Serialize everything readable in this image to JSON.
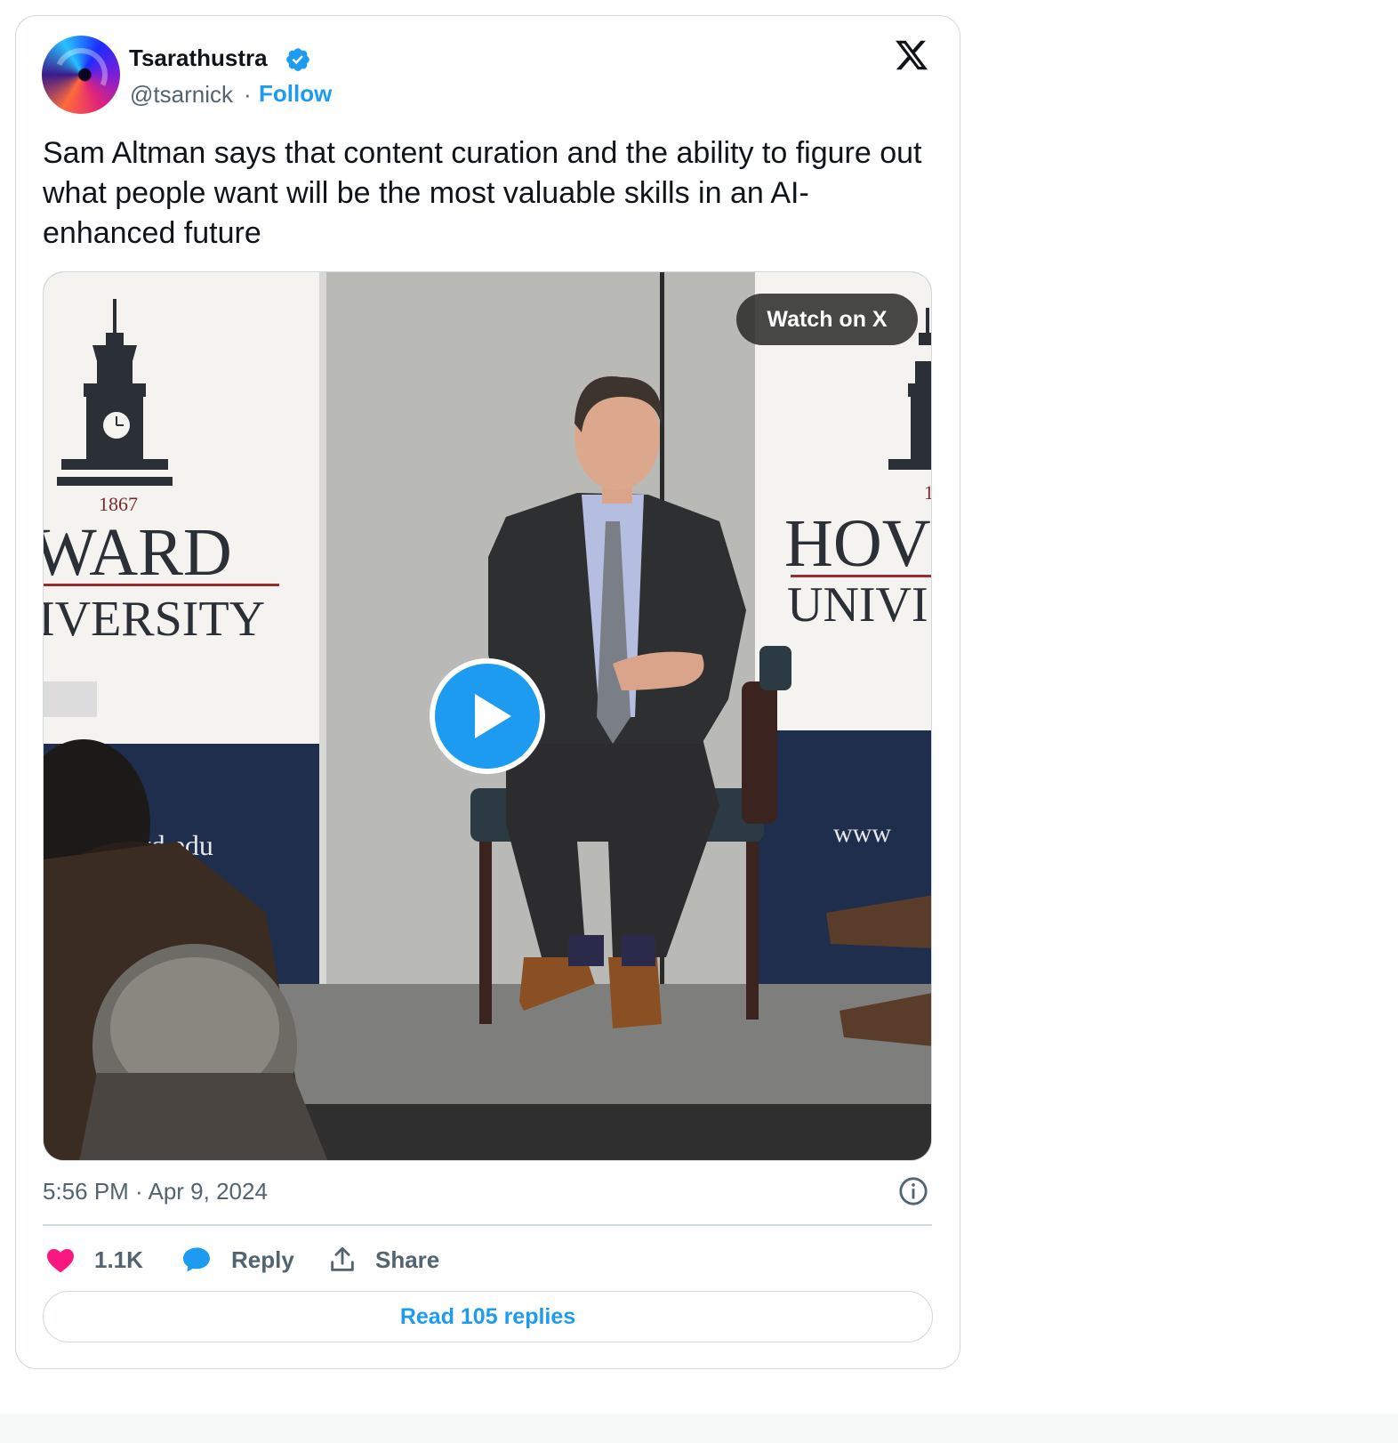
{
  "author": {
    "name": "Tsarathustra",
    "handle": "@tsarnick",
    "separator": "·",
    "follow_label": "Follow",
    "verified": true
  },
  "tweet": {
    "text": "Sam Altman says that content curation and the ability to figure out what people want will be the most valuable skills in an AI-enhanced future",
    "timestamp": "5:56 PM · Apr 9, 2024"
  },
  "media": {
    "watch_label": "Watch on X",
    "banner_left": {
      "year": "1867",
      "line1": "WARD",
      "line2": "IVERSITY",
      "url_fragment": "rd.edu"
    },
    "banner_right": {
      "year": "1",
      "line1": "HOV",
      "line2": "UNIVI",
      "url_fragment": "www"
    }
  },
  "actions": {
    "like_count": "1.1K",
    "reply_label": "Reply",
    "share_label": "Share",
    "read_replies_label": "Read 105 replies"
  },
  "colors": {
    "accent": "#1d9bf0",
    "like": "#f91880",
    "text_secondary": "#536471",
    "border": "#cfd9de"
  },
  "icons": [
    "x-logo-icon",
    "verified-badge-icon",
    "play-icon",
    "info-icon",
    "heart-icon",
    "reply-bubble-icon",
    "share-icon"
  ]
}
